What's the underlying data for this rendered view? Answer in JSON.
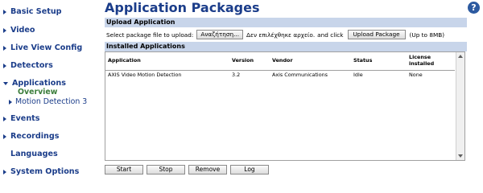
{
  "sidebar": {
    "items": [
      {
        "label": "Basic Setup"
      },
      {
        "label": "Video"
      },
      {
        "label": "Live View Config"
      },
      {
        "label": "Detectors"
      },
      {
        "label": "Applications"
      },
      {
        "label": "Events"
      },
      {
        "label": "Recordings"
      },
      {
        "label": "Languages"
      },
      {
        "label": "System Options"
      }
    ],
    "sub": {
      "overview": "Overview",
      "motion": "Motion Detection 3"
    }
  },
  "page": {
    "title": "Application Packages",
    "help_icon": "?"
  },
  "upload": {
    "header": "Upload Application",
    "prompt": "Select package file to upload:",
    "browse_label": "Αναζήτηση...",
    "no_file_text": "Δεν επιλέχθηκε αρχείο.",
    "and_click": "and click",
    "upload_label": "Upload Package",
    "limit": "(Up to 8MB)"
  },
  "installed": {
    "header": "Installed Applications",
    "columns": [
      "Application",
      "Version",
      "Vendor",
      "Status",
      "License",
      "installed"
    ],
    "rows": [
      {
        "application": "AXIS Video Motion Detection",
        "version": "3.2",
        "vendor": "Axis Communications",
        "status": "Idle",
        "license": "None"
      }
    ]
  },
  "actions": {
    "start": "Start",
    "stop": "Stop",
    "remove": "Remove",
    "log": "Log"
  },
  "colors": {
    "nav_text": "#1b3d8a",
    "active_sub": "#3a7d3a",
    "section_bar": "#c8d5ea"
  }
}
